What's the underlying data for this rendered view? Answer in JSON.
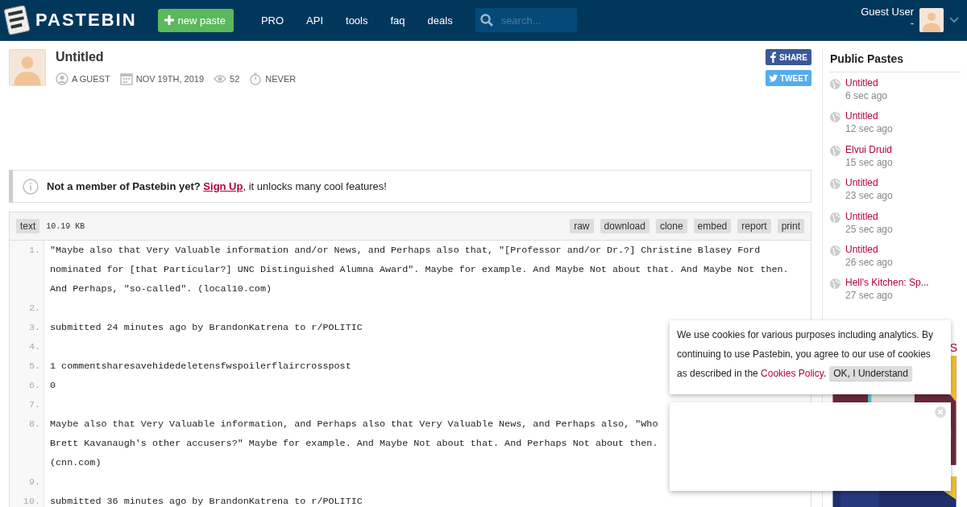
{
  "header": {
    "brand": "PASTEBIN",
    "new_paste": "new paste",
    "nav": [
      "PRO",
      "API",
      "tools",
      "faq",
      "deals"
    ],
    "search": {
      "placeholder": "search..."
    },
    "user": {
      "name": "Guest User",
      "sub": "-"
    }
  },
  "paste": {
    "title": "Untitled",
    "meta": [
      {
        "kind": "user",
        "text": "A GUEST"
      },
      {
        "kind": "date",
        "text": "NOV 19TH, 2019"
      },
      {
        "kind": "views",
        "text": "52"
      },
      {
        "kind": "expire",
        "text": "NEVER"
      }
    ],
    "share": [
      {
        "kind": "facebook",
        "label": "SHARE"
      },
      {
        "kind": "twitter",
        "label": "TWEET"
      }
    ]
  },
  "notice": {
    "before": "**Not a member of Pastebin yet?** ",
    "link": "Sign Up",
    "after": ", it unlocks many cool features!"
  },
  "code": {
    "format": "text",
    "size": "10.19 KB",
    "actions": [
      "raw",
      "download",
      "clone",
      "embed",
      "report",
      "print"
    ],
    "lines": [
      {
        "number": "1.",
        "segments": [
          "\"Maybe also that Very Valuable information and/or News, and Perhaps also that, \"[Professor and/or Dr.?] Christine Blasey Ford",
          "nominated for [that Particular?] UNC Distinguished Alumna Award\". Maybe for example. And Maybe Not about that. And Maybe Not then.",
          "And Perhaps, \"so-called\". (local10.com)"
        ]
      },
      {
        "number": "2."
      },
      {
        "number": "3.",
        "segments": [
          "submitted 24 minutes ago by BrandonKatrena to r/POLITIC"
        ]
      },
      {
        "number": "4."
      },
      {
        "number": "5.",
        "segments": [
          "1 commentsharesavehidedeletensfwspoilerflaircrosspost"
        ]
      },
      {
        "number": "6.",
        "segments": [
          "0"
        ]
      },
      {
        "number": "7."
      },
      {
        "number": "8.",
        "segments": [
          "Maybe also that Very Valuable information, and Perhaps also that Very Valuable News, and Perhaps also, \"Who",
          "Brett Kavanaugh's other accusers?\" Maybe for example. And Maybe Not about that. And Perhaps Not about then.",
          "(cnn.com)"
        ]
      },
      {
        "number": "9."
      },
      {
        "number": "10.",
        "segments": [
          "submitted 36 minutes ago by BrandonKatrena to r/POLITIC"
        ]
      }
    ]
  },
  "sidebar": {
    "title": "Public Pastes",
    "items": [
      {
        "title": "Untitled",
        "time": "6 sec ago"
      },
      {
        "title": "Untitled",
        "time": "12 sec ago"
      },
      {
        "title": "Elvui Druid",
        "time": "15 sec ago"
      },
      {
        "title": "Untitled",
        "time": "23 sec ago"
      },
      {
        "title": "Untitled",
        "time": "25 sec ago"
      },
      {
        "title": "Untitled",
        "time": "26 sec ago"
      },
      {
        "title": "Hell's Kitchen: Sp...",
        "time": "27 sec ago"
      }
    ],
    "heading_fragment": "S"
  },
  "cookie_notice": {
    "text": "We use cookies for various purposes including analytics. By continuing to use Pastebin, you agree to our use of cookies",
    "text_end": "as described in the ",
    "link": "Cookies Policy",
    "after": ".",
    "button": "OK, I Understand"
  }
}
